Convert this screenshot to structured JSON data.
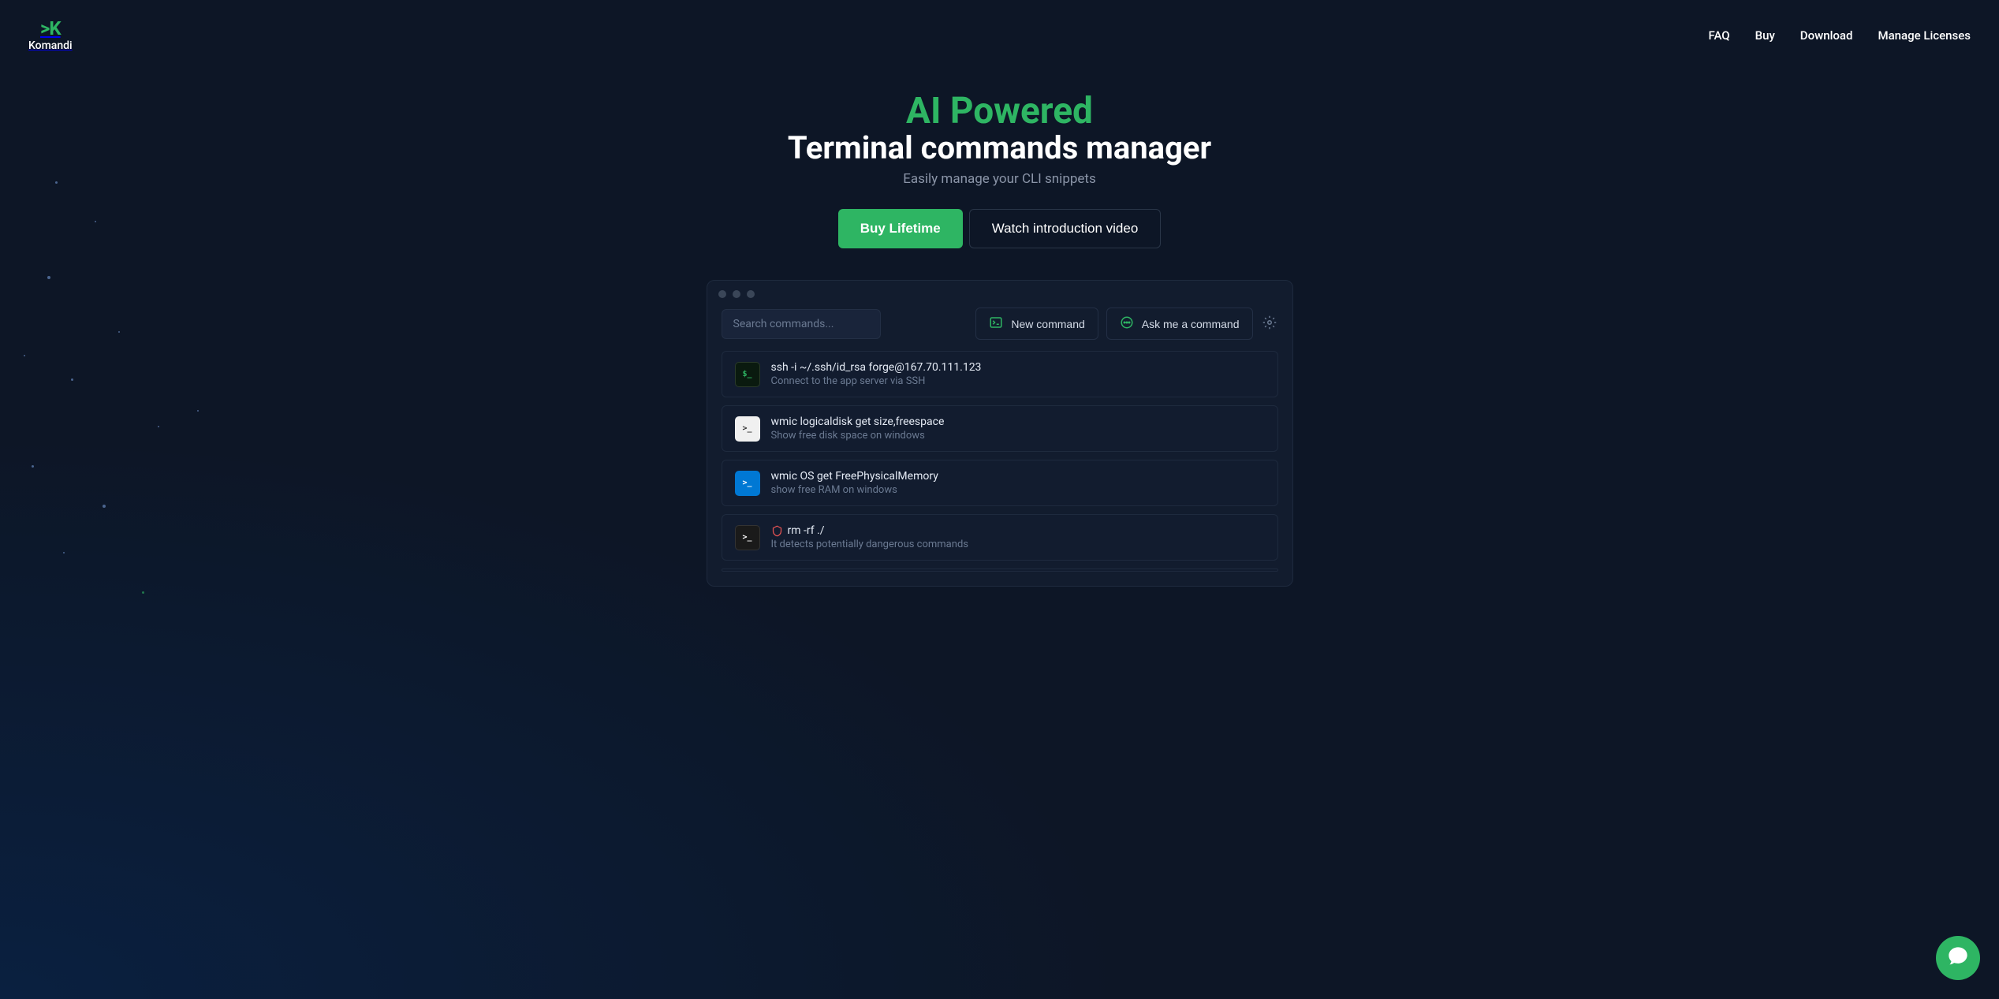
{
  "brand": {
    "mark": ">K",
    "name": "Komandi"
  },
  "nav": {
    "faq": "FAQ",
    "buy": "Buy",
    "download": "Download",
    "licenses": "Manage Licenses"
  },
  "hero": {
    "title_accent": "AI Powered",
    "title_main": "Terminal commands manager",
    "subtitle": "Easily manage your CLI snippets",
    "cta_primary": "Buy Lifetime",
    "cta_secondary": "Watch introduction video"
  },
  "app": {
    "search_placeholder": "Search commands...",
    "new_command_label": "New command",
    "ask_command_label": "Ask me a command",
    "commands": [
      {
        "title": "ssh -i ~/.ssh/id_rsa forge@167.70.111.123",
        "desc": "Connect to the app server via SSH",
        "icon": "green-term",
        "glyph": "$_"
      },
      {
        "title": "wmic logicaldisk get size,freespace",
        "desc": "Show free disk space on windows",
        "icon": "win-term",
        "glyph": ">_"
      },
      {
        "title": "wmic OS get FreePhysicalMemory",
        "desc": "show free RAM on windows",
        "icon": "ps-term",
        "glyph": ">_"
      },
      {
        "title": "rm -rf ./",
        "desc": "It detects potentially dangerous commands",
        "icon": "dark-term",
        "glyph": ">_",
        "danger": true
      }
    ]
  },
  "colors": {
    "accent": "#2eb563",
    "bg": "#0d1626",
    "danger": "#e55353"
  }
}
